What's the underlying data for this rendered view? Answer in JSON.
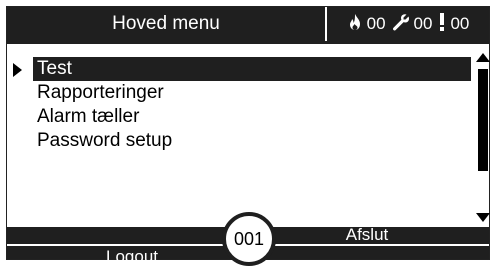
{
  "header": {
    "title": "Hoved menu",
    "counters": [
      {
        "icon": "flame-icon",
        "value": "00"
      },
      {
        "icon": "wrench-icon",
        "value": "00"
      },
      {
        "icon": "exclamation-icon",
        "value": "00"
      }
    ]
  },
  "menu": {
    "items": [
      {
        "label": "Test",
        "selected": true
      },
      {
        "label": "Rapporteringer",
        "selected": false
      },
      {
        "label": "Alarm tæller",
        "selected": false
      },
      {
        "label": "Password setup",
        "selected": false
      }
    ]
  },
  "footer": {
    "afslut_label": "Afslut",
    "logout_label": "Logout",
    "badge_value": "001"
  },
  "colors": {
    "bar": "#1f1f1f",
    "background": "#ffffff"
  }
}
